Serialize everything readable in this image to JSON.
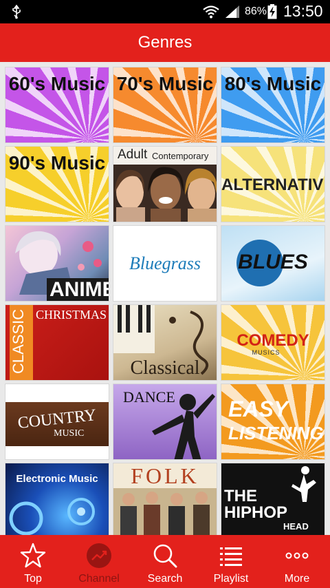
{
  "status_bar": {
    "battery_percent": "86%",
    "time": "13:50",
    "icons": [
      "usb-icon",
      "wifi-icon",
      "signal-icon",
      "battery-charging-icon"
    ]
  },
  "header": {
    "title": "Genres"
  },
  "colors": {
    "accent": "#e3211c",
    "active_nav": "#8c1512"
  },
  "genres": [
    {
      "name": "60's Music"
    },
    {
      "name": "70's Music"
    },
    {
      "name": "80's Music"
    },
    {
      "name": "90's Music"
    },
    {
      "name": "Adult",
      "sub": "Contemporary"
    },
    {
      "name": "ALTERNATIVE"
    },
    {
      "name": "ANIME"
    },
    {
      "name": "Bluegrass"
    },
    {
      "name": "BLUES"
    },
    {
      "name": "CLASSIC",
      "sub": "CHRISTMAS"
    },
    {
      "name": "Classical"
    },
    {
      "name": "COMEDY",
      "sub": "MUSICS"
    },
    {
      "name": "COUNTRY",
      "sub": "MUSIC"
    },
    {
      "name": "DANCE"
    },
    {
      "name": "EASY",
      "sub": "LISTENING"
    },
    {
      "name": "Electronic Music"
    },
    {
      "name": "FOLK"
    },
    {
      "name": "THE HIPHOP",
      "sub": "HEAD"
    }
  ],
  "bottom_nav": [
    {
      "label": "Top",
      "icon": "star-icon"
    },
    {
      "label": "Channel",
      "icon": "trending-icon",
      "active": true
    },
    {
      "label": "Search",
      "icon": "search-icon"
    },
    {
      "label": "Playlist",
      "icon": "playlist-icon"
    },
    {
      "label": "More",
      "icon": "more-icon"
    }
  ]
}
